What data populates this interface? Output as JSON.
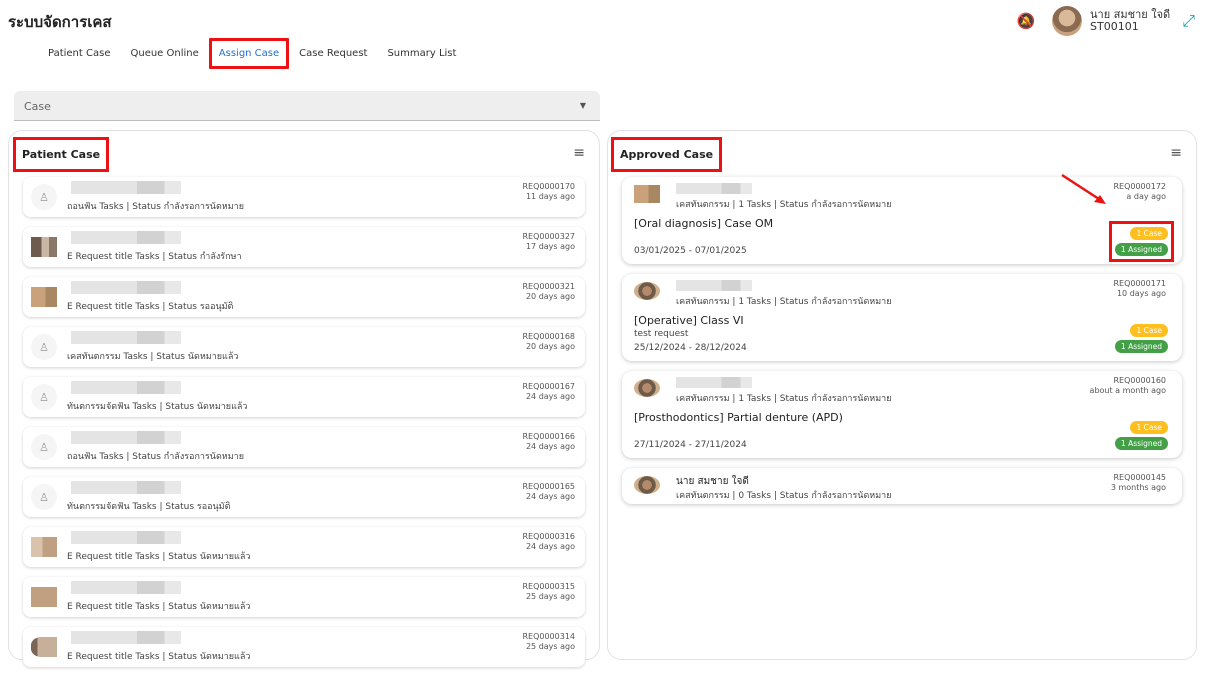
{
  "app": {
    "title": "ระบบจัดการเคส"
  },
  "user": {
    "name": "นาย สมชาย ใจดี",
    "id": "ST00101"
  },
  "tabs": [
    {
      "label": "Patient Case"
    },
    {
      "label": "Queue Online"
    },
    {
      "label": "Assign Case"
    },
    {
      "label": "Case Request"
    },
    {
      "label": "Summary List"
    }
  ],
  "active_tab": "Assign Case",
  "case_select": {
    "label": "Case"
  },
  "left_panel": {
    "title": "Patient Case",
    "rows": [
      {
        "sub": "ถอนฟัน Tasks | Status กำลังรอการนัดหมาย",
        "ref": "REQ0000170",
        "time": "11 days ago",
        "thumb": "person"
      },
      {
        "sub": "E Request title Tasks | Status กำลังรักษา",
        "ref": "REQ0000327",
        "time": "17 days ago",
        "thumb": "img1"
      },
      {
        "sub": "E Request title Tasks | Status รออนุมัติ",
        "ref": "REQ0000321",
        "time": "20 days ago",
        "thumb": "img2"
      },
      {
        "sub": "เคสทันตกรรม Tasks | Status นัดหมายแล้ว",
        "ref": "REQ0000168",
        "time": "20 days ago",
        "thumb": "person"
      },
      {
        "sub": "ทันตกรรมจัดฟัน Tasks | Status นัดหมายแล้ว",
        "ref": "REQ0000167",
        "time": "24 days ago",
        "thumb": "person"
      },
      {
        "sub": "ถอนฟัน Tasks | Status กำลังรอการนัดหมาย",
        "ref": "REQ0000166",
        "time": "24 days ago",
        "thumb": "person"
      },
      {
        "sub": "ทันตกรรมจัดฟัน Tasks | Status รออนุมัติ",
        "ref": "REQ0000165",
        "time": "24 days ago",
        "thumb": "person"
      },
      {
        "sub": "E Request title Tasks | Status นัดหมายแล้ว",
        "ref": "REQ0000316",
        "time": "24 days ago",
        "thumb": "img3"
      },
      {
        "sub": "E Request title Tasks | Status นัดหมายแล้ว",
        "ref": "REQ0000315",
        "time": "25 days ago",
        "thumb": "img4"
      },
      {
        "sub": "E Request title Tasks | Status นัดหมายแล้ว",
        "ref": "REQ0000314",
        "time": "25 days ago",
        "thumb": "img5"
      }
    ]
  },
  "right_panel": {
    "title": "Approved Case",
    "cards": [
      {
        "name": "",
        "sub": "เคสทันตกรรม | 1 Tasks | Status กำลังรอการนัดหมาย",
        "ref": "REQ0000172",
        "time": "a day ago",
        "title": "[Oral diagnosis] Case OM",
        "desc": "",
        "dates": "03/01/2025 - 07/01/2025",
        "case_badge": "1 Case",
        "assigned_badge": "1 Assigned",
        "highlight": true
      },
      {
        "name": "",
        "sub": "เคสทันตกรรม | 1 Tasks | Status กำลังรอการนัดหมาย",
        "ref": "REQ0000171",
        "time": "10 days ago",
        "title": "[Operative] Class VI",
        "desc": "test request",
        "dates": "25/12/2024 - 28/12/2024",
        "case_badge": "1 Case",
        "assigned_badge": "1 Assigned",
        "highlight": false
      },
      {
        "name": "",
        "sub": "เคสทันตกรรม | 1 Tasks | Status กำลังรอการนัดหมาย",
        "ref": "REQ0000160",
        "time": "about a month ago",
        "title": "[Prosthodontics] Partial denture (APD)",
        "desc": "",
        "dates": "27/11/2024 - 27/11/2024",
        "case_badge": "1 Case",
        "assigned_badge": "1 Assigned",
        "highlight": false
      },
      {
        "name": "นาย สมชาย ใจดี",
        "sub": "เคสทันตกรรม | 0 Tasks | Status กำลังรอการนัดหมาย",
        "ref": "REQ0000145",
        "time": "3 months ago",
        "title": "",
        "desc": "",
        "dates": "",
        "case_badge": "",
        "assigned_badge": "",
        "highlight": false
      }
    ]
  },
  "colors": {
    "accent": "#1f6fd6",
    "highlight": "#e11111",
    "case_badge": "#ffbf1f",
    "assigned_badge": "#43a047"
  },
  "icons": {
    "bell": "bell-off-icon",
    "expand": "expand-icon",
    "filter": "filter-icon",
    "dropdown": "chevron-down-icon",
    "person": "person-icon"
  }
}
